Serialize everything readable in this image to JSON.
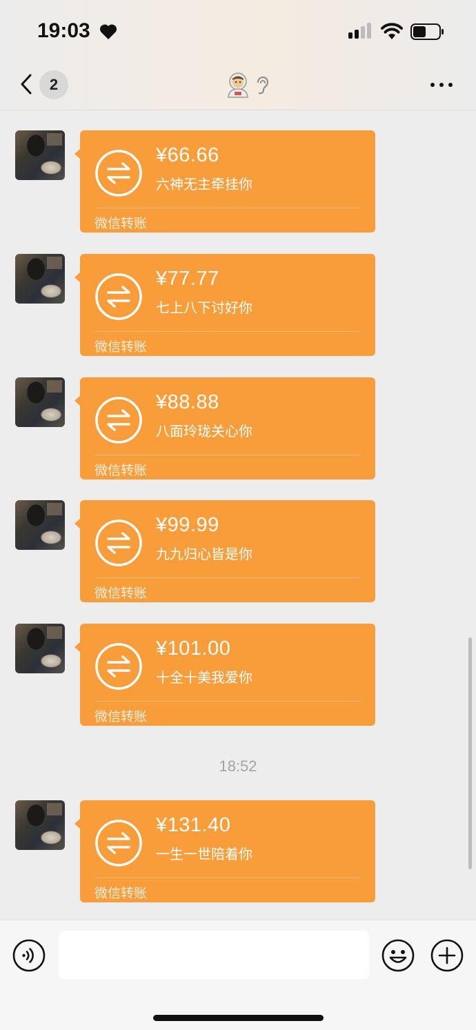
{
  "status_bar": {
    "time": "19:03",
    "icons": [
      "heart-icon",
      "cellular-signal-icon",
      "wifi-icon",
      "battery-icon"
    ]
  },
  "nav": {
    "back_count": "2",
    "title_emoji": "🧑‍🚀",
    "title_icon": "ear-icon",
    "more_icon": "more-dots-icon"
  },
  "messages": [
    {
      "amount": "¥66.66",
      "note": "六神无主牵挂你",
      "label": "微信转账"
    },
    {
      "amount": "¥77.77",
      "note": "七上八下讨好你",
      "label": "微信转账"
    },
    {
      "amount": "¥88.88",
      "note": "八面玲珑关心你",
      "label": "微信转账"
    },
    {
      "amount": "¥99.99",
      "note": "九九归心皆是你",
      "label": "微信转账"
    },
    {
      "amount": "¥101.00",
      "note": "十全十美我爱你",
      "label": "微信转账"
    },
    {
      "amount": "¥131.40",
      "note": "一生一世陪着你",
      "label": "微信转账"
    }
  ],
  "timestamp": "18:52",
  "input_bar": {
    "input_value": "",
    "icons": [
      "voice-icon",
      "emoji-icon",
      "plus-icon"
    ]
  },
  "colors": {
    "bubble": "#f99d3a",
    "background": "#ededed",
    "timestamp": "#a3a3a3"
  }
}
